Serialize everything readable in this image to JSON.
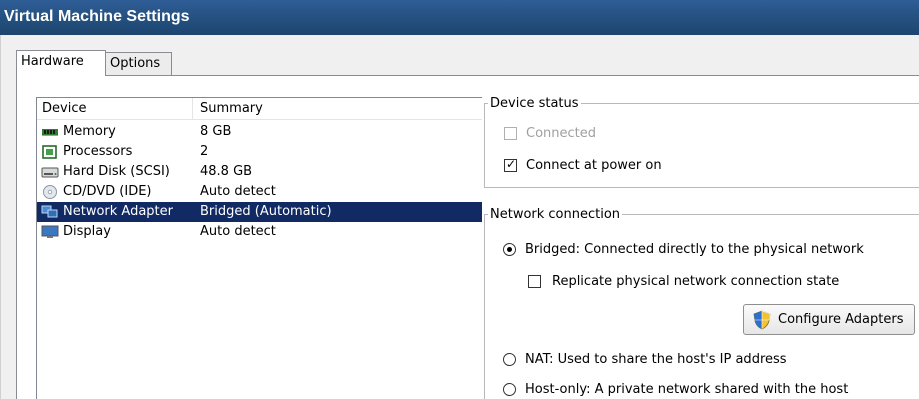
{
  "window": {
    "title": "Virtual Machine Settings"
  },
  "tabs": [
    {
      "label": "Hardware",
      "active": true
    },
    {
      "label": "Options",
      "active": false
    }
  ],
  "device_list": {
    "columns": [
      "Device",
      "Summary"
    ],
    "rows": [
      {
        "device": "Memory",
        "summary": "8 GB",
        "icon": "memory-icon"
      },
      {
        "device": "Processors",
        "summary": "2",
        "icon": "processor-icon"
      },
      {
        "device": "Hard Disk (SCSI)",
        "summary": "48.8 GB",
        "icon": "hard-disk-icon"
      },
      {
        "device": "CD/DVD (IDE)",
        "summary": "Auto detect",
        "icon": "cd-dvd-icon"
      },
      {
        "device": "Network Adapter",
        "summary": "Bridged (Automatic)",
        "icon": "network-adapter-icon",
        "selected": true
      },
      {
        "device": "Display",
        "summary": "Auto detect",
        "icon": "display-icon"
      }
    ]
  },
  "device_status": {
    "legend": "Device status",
    "connected": {
      "label": "Connected",
      "checked": false,
      "enabled": false
    },
    "connect_at_power_on": {
      "label": "Connect at power on",
      "checked": true,
      "enabled": true
    }
  },
  "network_connection": {
    "legend": "Network connection",
    "bridged": {
      "label": "Bridged: Connected directly to the physical network",
      "selected": true
    },
    "replicate": {
      "label": "Replicate physical network connection state",
      "checked": false
    },
    "configure_button": "Configure Adapters",
    "nat": {
      "label": "NAT: Used to share the host's IP address",
      "selected": false
    },
    "host_only": {
      "label": "Host-only: A private network shared with the host",
      "selected": false
    }
  },
  "colors": {
    "selection": "#112a63",
    "titlebar": "#24507f"
  }
}
